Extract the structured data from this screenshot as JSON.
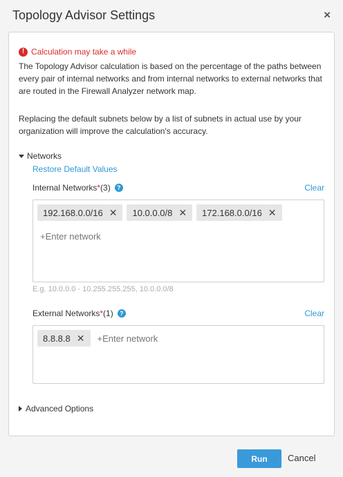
{
  "dialog": {
    "title": "Topology Advisor Settings",
    "close_glyph": "×"
  },
  "warning": {
    "icon_glyph": "!",
    "text": "Calculation may take a while",
    "color": "#d92b2b"
  },
  "description": {
    "para1": "The Topology Advisor calculation is based on the percentage of the paths between every pair of internal networks and from internal networks to external networks that are routed in the Firewall Analyzer network map.",
    "para2": "Replacing the default subnets below by a list of subnets in actual use by your organization will improve the calculation's accuracy."
  },
  "networks_section": {
    "label": "Networks",
    "expanded": true,
    "restore_link": "Restore Default Values"
  },
  "internal": {
    "label": "Internal Networks",
    "required_mark": "*",
    "count": "(3)",
    "help_glyph": "?",
    "clear_label": "Clear",
    "chips": [
      "192.168.0.0/16",
      "10.0.0.0/8",
      "172.168.0.0/16"
    ],
    "placeholder": "+Enter network",
    "hint": "E.g. 10.0.0.0 - 10.255.255.255, 10.0.0.0/8"
  },
  "external": {
    "label": "External Networks",
    "required_mark": "*",
    "count": "(1)",
    "help_glyph": "?",
    "clear_label": "Clear",
    "chips": [
      "8.8.8.8"
    ],
    "placeholder": "+Enter network"
  },
  "advanced": {
    "label": "Advanced Options",
    "expanded": false
  },
  "footer": {
    "run_label": "Run",
    "cancel_label": "Cancel",
    "accent": "#3a9ad9"
  },
  "chip_remove_glyph": "✕"
}
